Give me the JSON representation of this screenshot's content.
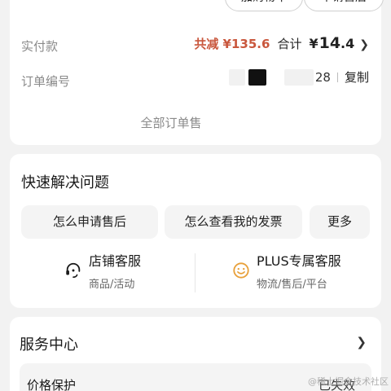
{
  "order": {
    "add_cart_button": "加购物车",
    "after_sale_button": "申请售后",
    "paid_label": "实付款",
    "discount_text": "共减 ¥135.6",
    "total_label": "合计",
    "total_currency": "¥",
    "total_int": "14",
    "total_dec": ".4",
    "orderno_label": "订单编号",
    "orderno_tail": "28",
    "copy_button": "复制",
    "all_after_sale": "全部订单售"
  },
  "quick": {
    "title": "快速解决问题",
    "chips": [
      "怎么申请售后",
      "怎么查看我的发票",
      "更多"
    ],
    "services": [
      {
        "title": "店铺客服",
        "subtitle": "商品/活动",
        "icon": "headset-icon"
      },
      {
        "title": "PLUS专属客服",
        "subtitle": "物流/售后/平台",
        "icon": "smile-icon"
      }
    ]
  },
  "service_center": {
    "title": "服务中心",
    "price_protect_label": "价格保护",
    "price_protect_status": "已失效"
  },
  "watermark": "@稀土掘金技术社区",
  "colors": {
    "accent": "#c9573d",
    "smile_icon": "#e8a03a"
  }
}
